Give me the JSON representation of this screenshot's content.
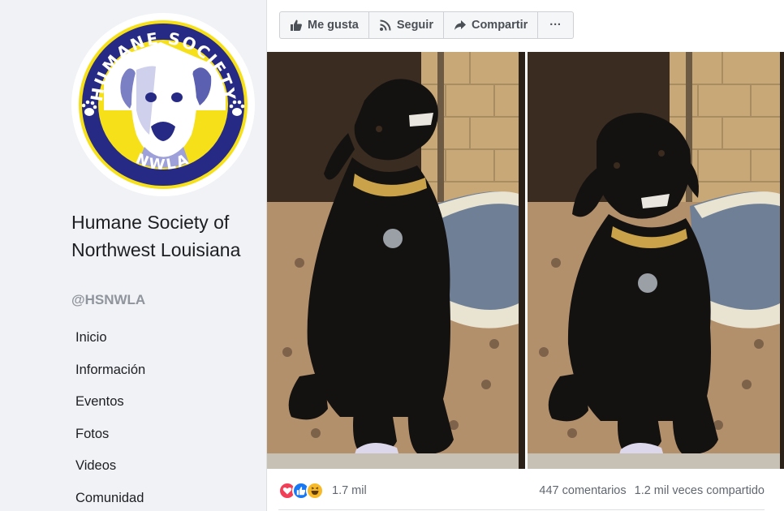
{
  "page": {
    "logo_text_top": "HUMANE SOCIETY",
    "logo_text_bottom": "NWLA",
    "name": "Humane Society of Northwest Louisiana",
    "handle": "@HSNWLA"
  },
  "nav": {
    "items": [
      {
        "label": "Inicio"
      },
      {
        "label": "Información"
      },
      {
        "label": "Eventos"
      },
      {
        "label": "Fotos"
      },
      {
        "label": "Videos"
      },
      {
        "label": "Comunidad"
      }
    ]
  },
  "actions": {
    "like": "Me gusta",
    "follow": "Seguir",
    "share": "Compartir",
    "more": "···"
  },
  "post": {
    "reaction_count": "1.7 mil",
    "comments": "447 comentarios",
    "shares": "1.2 mil veces compartido"
  },
  "colors": {
    "facebook_blue": "#1877f2",
    "logo_navy": "#262a84",
    "logo_yellow": "#f5e01a",
    "love_red": "#f33e58",
    "haha_yellow": "#f7b928"
  },
  "icons": [
    "like-icon",
    "rss-icon",
    "share-icon",
    "more-icon",
    "love-reaction-icon",
    "like-reaction-icon",
    "haha-reaction-icon"
  ]
}
